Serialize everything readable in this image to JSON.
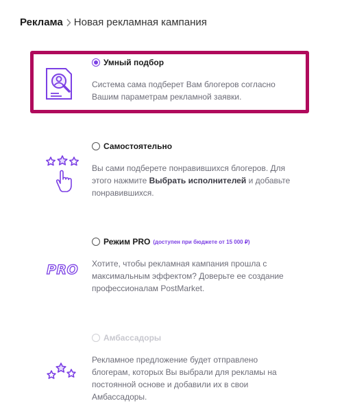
{
  "breadcrumb": {
    "root": "Реклама",
    "current": "Новая рекламная кампания"
  },
  "options": [
    {
      "title": "Умный подбор",
      "selected": true,
      "desc": "Система сама подберет Вам блогеров согласно Вашим параметрам рекламной заявки.",
      "icon": "document-search-icon"
    },
    {
      "title": "Самостоятельно",
      "selected": false,
      "desc_before": "Вы сами подберете понравившихся блогеров. Для этого нажмите ",
      "desc_bold": "Выбрать исполнителей",
      "desc_after": " и добавьте понравившихся.",
      "icon": "stars-hand-icon"
    },
    {
      "title": "Режим PRO",
      "note": "(доступен при бюджете от 15 000 ₽)",
      "selected": false,
      "desc": "Хотите, чтобы рекламная кампания прошла с максимальным эффектом? Доверьте ее создание профессионалам PostMarket.",
      "icon_text": "PRO"
    },
    {
      "title": "Амбассадоры",
      "selected": false,
      "disabled": true,
      "desc": "Рекламное предложение будет отправлено блогерам, которых Вы выбрали для рекламы на постоянной основе и добавили их в свои Амбассадоры.",
      "icon": "stars-icon"
    }
  ],
  "colors": {
    "accent": "#7b3fe4",
    "highlight": "#b00a5c",
    "disabled": "#c8c8cf"
  }
}
